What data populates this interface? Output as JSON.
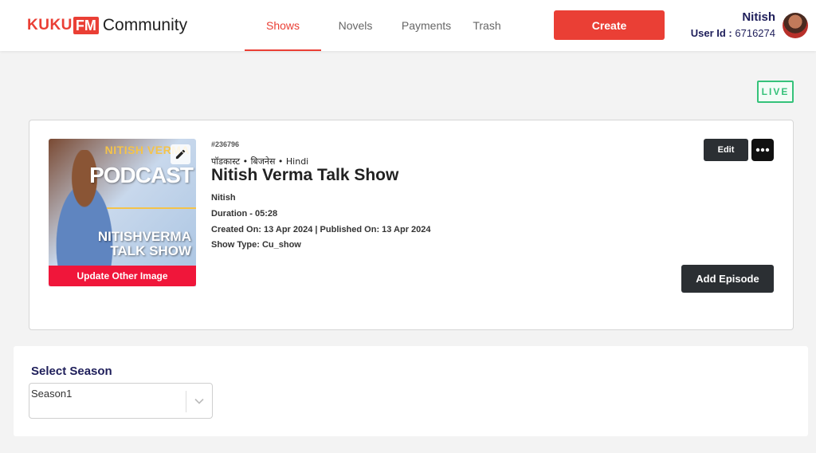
{
  "brand": {
    "kuku": "KUKU",
    "fm": "FM",
    "community": "Community"
  },
  "nav": {
    "tabs": [
      {
        "label": "Shows",
        "active": true
      },
      {
        "label": "Novels",
        "active": false
      },
      {
        "label": "Payments",
        "active": false
      },
      {
        "label": "Trash",
        "active": false
      }
    ]
  },
  "header": {
    "create_label": "Create"
  },
  "user": {
    "name": "Nitish",
    "id_label": "User Id :",
    "id_value": "6716274"
  },
  "status": {
    "badge": "LIVE",
    "color": "#35c27a"
  },
  "show": {
    "id": "#236796",
    "tags": "पॉडकास्ट • बिजनेस • Hindi",
    "title": "Nitish Verma Talk Show",
    "author": "Nitish",
    "duration": "Duration - 05:28",
    "dates": "Created On: 13 Apr 2024 | Published On: 13 Apr 2024",
    "type": "Show Type: Cu_show",
    "cover_text": {
      "line1": "NITISH VERMA",
      "line2": "PODCAST",
      "line3": "NITISHVERMA",
      "line4": "TALK SHOW"
    },
    "update_image_label": "Update Other Image",
    "edit_label": "Edit",
    "add_episode_label": "Add Episode"
  },
  "season": {
    "label": "Select Season",
    "selected": "Season1"
  },
  "colors": {
    "accent": "#ea3f35",
    "dark": "#2b2f33",
    "navy": "#1e1e5a"
  },
  "icons": {
    "cover_edit": "pencil-icon",
    "more": "more-dots-icon",
    "dropdown": "chevron-down-icon"
  }
}
